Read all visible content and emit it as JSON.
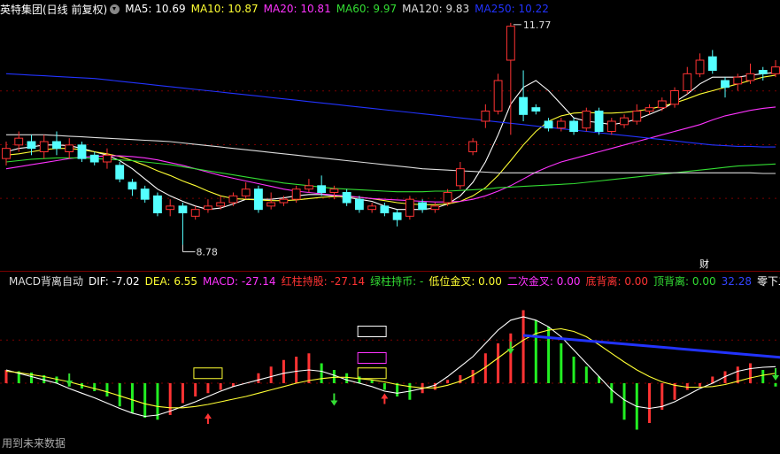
{
  "main_legend": {
    "title": "英特集团(日线 前复权)",
    "items": [
      {
        "label": "MA5: 10.69",
        "color": "#ffffff"
      },
      {
        "label": "MA10: 10.87",
        "color": "#ffff33"
      },
      {
        "label": "MA20: 10.81",
        "color": "#ff33ff"
      },
      {
        "label": "MA60: 9.97",
        "color": "#33dd33"
      },
      {
        "label": "MA120: 9.83",
        "color": "#dddddd"
      },
      {
        "label": "MA250: 10.22",
        "color": "#2233ff"
      }
    ]
  },
  "macd_legend": {
    "title": "MACD背离自动",
    "items": [
      {
        "label": "DIF: -7.02",
        "color": "#ffffff"
      },
      {
        "label": "DEA: 6.55",
        "color": "#ffff33"
      },
      {
        "label": "MACD: -27.14",
        "color": "#ff33ff"
      },
      {
        "label": "红柱持股: -27.14",
        "color": "#ff3333"
      },
      {
        "label": "绿柱持币: -",
        "color": "#33dd33"
      },
      {
        "label": "低位金叉: 0.00",
        "color": "#ffff33"
      },
      {
        "label": "二次金叉: 0.00",
        "color": "#ff33ff"
      },
      {
        "label": "底背离: 0.00",
        "color": "#ff3333"
      },
      {
        "label": "顶背离: 0.00",
        "color": "#33dd33"
      },
      {
        "label": "32.28",
        "color": "#3344ff"
      },
      {
        "label": "零下二次金叉",
        "color": "#ffffff"
      }
    ]
  },
  "annotations": {
    "high_label": "11.77",
    "low_label": "8.78",
    "cai_badge": "财"
  },
  "footer": "用到未来数据",
  "colors": {
    "up": "#ff3333",
    "down": "#54ffff",
    "grid": "#7a0000"
  },
  "chart_data": [
    {
      "type": "candlestick",
      "title": "英特集团(日线 前复权)",
      "ylim": [
        8.5,
        12.1
      ],
      "candles": [
        [
          10.05,
          10.2,
          10.3,
          9.95
        ],
        [
          10.25,
          10.35,
          10.45,
          10.15
        ],
        [
          10.3,
          10.2,
          10.4,
          10.1
        ],
        [
          10.15,
          10.3,
          10.4,
          10.05
        ],
        [
          10.3,
          10.2,
          10.45,
          10.1
        ],
        [
          10.15,
          10.25,
          10.35,
          10.05
        ],
        [
          10.25,
          10.05,
          10.3,
          10.0
        ],
        [
          10.1,
          10.0,
          10.15,
          9.95
        ],
        [
          10.0,
          10.1,
          10.2,
          9.9
        ],
        [
          9.95,
          9.75,
          10.0,
          9.7
        ],
        [
          9.7,
          9.6,
          9.75,
          9.5
        ],
        [
          9.6,
          9.45,
          9.65,
          9.4
        ],
        [
          9.5,
          9.25,
          9.55,
          9.2
        ],
        [
          9.3,
          9.35,
          9.45,
          9.2
        ],
        [
          9.35,
          9.25,
          9.4,
          8.78
        ],
        [
          9.2,
          9.3,
          9.35,
          9.15
        ],
        [
          9.3,
          9.35,
          9.45,
          9.25
        ],
        [
          9.35,
          9.4,
          9.5,
          9.3
        ],
        [
          9.4,
          9.5,
          9.55,
          9.35
        ],
        [
          9.5,
          9.6,
          9.7,
          9.45
        ],
        [
          9.6,
          9.3,
          9.65,
          9.25
        ],
        [
          9.35,
          9.4,
          9.55,
          9.3
        ],
        [
          9.4,
          9.45,
          9.5,
          9.35
        ],
        [
          9.45,
          9.6,
          9.65,
          9.4
        ],
        [
          9.6,
          9.65,
          9.75,
          9.55
        ],
        [
          9.65,
          9.55,
          9.8,
          9.5
        ],
        [
          9.55,
          9.6,
          9.65,
          9.45
        ],
        [
          9.55,
          9.4,
          9.6,
          9.35
        ],
        [
          9.45,
          9.3,
          9.5,
          9.25
        ],
        [
          9.3,
          9.35,
          9.4,
          9.25
        ],
        [
          9.35,
          9.25,
          9.4,
          9.2
        ],
        [
          9.25,
          9.15,
          9.3,
          9.05
        ],
        [
          9.2,
          9.45,
          9.5,
          9.15
        ],
        [
          9.4,
          9.3,
          9.45,
          9.25
        ],
        [
          9.3,
          9.35,
          9.4,
          9.25
        ],
        [
          9.4,
          9.55,
          9.6,
          9.35
        ],
        [
          9.65,
          9.9,
          10.0,
          9.6
        ],
        [
          10.15,
          10.3,
          10.35,
          10.1
        ],
        [
          10.6,
          10.75,
          10.85,
          10.5
        ],
        [
          10.75,
          11.2,
          11.3,
          10.7
        ],
        [
          11.5,
          12.0,
          12.05,
          10.4
        ],
        [
          10.95,
          10.7,
          11.35,
          10.6
        ],
        [
          10.8,
          10.75,
          10.85,
          10.7
        ],
        [
          10.6,
          10.5,
          10.65,
          10.45
        ],
        [
          10.5,
          10.6,
          10.65,
          10.45
        ],
        [
          10.6,
          10.45,
          10.65,
          10.4
        ],
        [
          10.5,
          10.75,
          10.8,
          10.45
        ],
        [
          10.75,
          10.45,
          10.8,
          10.4
        ],
        [
          10.45,
          10.6,
          10.65,
          10.4
        ],
        [
          10.55,
          10.65,
          10.7,
          10.5
        ],
        [
          10.6,
          10.75,
          10.85,
          10.55
        ],
        [
          10.75,
          10.8,
          10.85,
          10.7
        ],
        [
          10.8,
          10.9,
          10.95,
          10.75
        ],
        [
          10.85,
          11.05,
          11.1,
          10.8
        ],
        [
          11.05,
          11.3,
          11.4,
          11.0
        ],
        [
          11.3,
          11.5,
          11.6,
          11.25
        ],
        [
          11.55,
          11.35,
          11.65,
          11.3
        ],
        [
          11.2,
          11.1,
          11.25,
          10.95
        ],
        [
          11.15,
          11.25,
          11.3,
          11.05
        ],
        [
          11.2,
          11.3,
          11.45,
          11.15
        ],
        [
          11.35,
          11.3,
          11.4,
          11.2
        ],
        [
          11.3,
          11.4,
          11.5,
          11.25
        ]
      ],
      "ma_series": [
        {
          "name": "MA5",
          "color": "#ffffff",
          "values": [
            10.15,
            10.2,
            10.22,
            10.25,
            10.25,
            10.24,
            10.2,
            10.15,
            10.1,
            10.02,
            9.9,
            9.75,
            9.6,
            9.5,
            9.42,
            9.35,
            9.3,
            9.32,
            9.38,
            9.45,
            9.45,
            9.45,
            9.47,
            9.5,
            9.52,
            9.52,
            9.5,
            9.48,
            9.45,
            9.42,
            9.35,
            9.3,
            9.3,
            9.3,
            9.32,
            9.38,
            9.5,
            9.7,
            10.0,
            10.4,
            10.85,
            11.1,
            11.2,
            11.05,
            10.85,
            10.65,
            10.6,
            10.58,
            10.55,
            10.58,
            10.63,
            10.7,
            10.78,
            10.88,
            11.0,
            11.15,
            11.25,
            11.25,
            11.25,
            11.28,
            11.3,
            11.32
          ]
        },
        {
          "name": "MA10",
          "color": "#ffff33",
          "values": [
            10.1,
            10.12,
            10.15,
            10.18,
            10.2,
            10.2,
            10.18,
            10.15,
            10.12,
            10.08,
            10.02,
            9.95,
            9.87,
            9.8,
            9.72,
            9.65,
            9.57,
            9.5,
            9.46,
            9.45,
            9.44,
            9.43,
            9.43,
            9.44,
            9.46,
            9.48,
            9.49,
            9.49,
            9.48,
            9.46,
            9.43,
            9.4,
            9.38,
            9.37,
            9.37,
            9.38,
            9.42,
            9.5,
            9.62,
            9.8,
            10.02,
            10.25,
            10.45,
            10.6,
            10.68,
            10.72,
            10.73,
            10.72,
            10.72,
            10.73,
            10.75,
            10.78,
            10.82,
            10.87,
            10.93,
            11.0,
            11.05,
            11.1,
            11.15,
            11.2,
            11.25,
            11.28
          ]
        },
        {
          "name": "MA20",
          "color": "#ff33ff",
          "values": [
            9.9,
            9.93,
            9.96,
            9.99,
            10.02,
            10.05,
            10.07,
            10.08,
            10.09,
            10.09,
            10.08,
            10.06,
            10.03,
            9.99,
            9.95,
            9.9,
            9.85,
            9.8,
            9.76,
            9.72,
            9.68,
            9.64,
            9.6,
            9.57,
            9.55,
            9.53,
            9.51,
            9.5,
            9.48,
            9.46,
            9.45,
            9.44,
            9.43,
            9.42,
            9.41,
            9.41,
            9.42,
            9.45,
            9.5,
            9.57,
            9.65,
            9.75,
            9.85,
            9.93,
            10.0,
            10.05,
            10.1,
            10.15,
            10.2,
            10.25,
            10.3,
            10.35,
            10.4,
            10.45,
            10.5,
            10.55,
            10.62,
            10.68,
            10.72,
            10.76,
            10.79,
            10.81
          ]
        },
        {
          "name": "MA60",
          "color": "#33dd33",
          "values": [
            10.0,
            10.02,
            10.04,
            10.05,
            10.06,
            10.06,
            10.06,
            10.05,
            10.04,
            10.03,
            10.02,
            10.0,
            9.98,
            9.96,
            9.93,
            9.9,
            9.87,
            9.84,
            9.81,
            9.78,
            9.75,
            9.72,
            9.69,
            9.67,
            9.65,
            9.63,
            9.61,
            9.6,
            9.59,
            9.58,
            9.57,
            9.56,
            9.56,
            9.56,
            9.57,
            9.57,
            9.58,
            9.59,
            9.6,
            9.62,
            9.63,
            9.64,
            9.65,
            9.66,
            9.67,
            9.68,
            9.7,
            9.72,
            9.74,
            9.76,
            9.78,
            9.8,
            9.82,
            9.84,
            9.86,
            9.88,
            9.9,
            9.92,
            9.94,
            9.95,
            9.96,
            9.97
          ]
        },
        {
          "name": "MA120",
          "color": "#dddddd",
          "values": [
            10.4,
            10.4,
            10.4,
            10.4,
            10.39,
            10.38,
            10.37,
            10.36,
            10.35,
            10.34,
            10.33,
            10.32,
            10.31,
            10.3,
            10.28,
            10.26,
            10.24,
            10.22,
            10.2,
            10.18,
            10.16,
            10.14,
            10.12,
            10.1,
            10.08,
            10.06,
            10.04,
            10.02,
            10.0,
            9.98,
            9.96,
            9.94,
            9.92,
            9.9,
            9.89,
            9.88,
            9.87,
            9.86,
            9.85,
            9.84,
            9.84,
            9.84,
            9.84,
            9.84,
            9.84,
            9.84,
            9.84,
            9.84,
            9.84,
            9.84,
            9.84,
            9.84,
            9.84,
            9.84,
            9.84,
            9.84,
            9.84,
            9.84,
            9.84,
            9.84,
            9.83,
            9.83
          ]
        },
        {
          "name": "MA250",
          "color": "#2233ff",
          "values": [
            11.3,
            11.29,
            11.28,
            11.27,
            11.26,
            11.25,
            11.24,
            11.23,
            11.21,
            11.19,
            11.17,
            11.15,
            11.13,
            11.11,
            11.09,
            11.07,
            11.05,
            11.03,
            11.01,
            10.99,
            10.97,
            10.95,
            10.93,
            10.91,
            10.89,
            10.87,
            10.85,
            10.83,
            10.81,
            10.79,
            10.77,
            10.75,
            10.73,
            10.71,
            10.69,
            10.67,
            10.65,
            10.63,
            10.61,
            10.59,
            10.57,
            10.55,
            10.53,
            10.51,
            10.49,
            10.47,
            10.45,
            10.43,
            10.41,
            10.39,
            10.37,
            10.35,
            10.33,
            10.31,
            10.29,
            10.27,
            10.25,
            10.24,
            10.23,
            10.23,
            10.22,
            10.22
          ]
        }
      ]
    },
    {
      "type": "bar",
      "title": "MACD背离自动",
      "ylim": [
        -100,
        140
      ],
      "values": [
        20,
        18,
        16,
        12,
        10,
        -5,
        -8,
        -12,
        -20,
        -35,
        -45,
        -52,
        -55,
        -48,
        -30,
        -20,
        -15,
        -10,
        -5,
        0,
        15,
        25,
        35,
        40,
        45,
        30,
        20,
        15,
        10,
        5,
        -10,
        -20,
        -25,
        -15,
        -10,
        5,
        12,
        20,
        45,
        60,
        75,
        110,
        95,
        85,
        60,
        40,
        25,
        10,
        -30,
        -55,
        -70,
        -60,
        -40,
        -25,
        -10,
        -5,
        10,
        18,
        25,
        30,
        20,
        -5
      ],
      "dif": [
        20,
        15,
        10,
        5,
        0,
        -8,
        -15,
        -22,
        -30,
        -38,
        -45,
        -50,
        -48,
        -42,
        -35,
        -28,
        -20,
        -12,
        -5,
        0,
        5,
        10,
        15,
        18,
        20,
        18,
        12,
        5,
        0,
        -5,
        -12,
        -15,
        -12,
        -8,
        -3,
        10,
        25,
        40,
        60,
        80,
        95,
        100,
        95,
        85,
        70,
        50,
        30,
        10,
        -10,
        -25,
        -35,
        -38,
        -35,
        -28,
        -18,
        -8,
        0,
        10,
        18,
        22,
        24,
        25
      ],
      "dea": [
        18,
        16,
        13,
        10,
        6,
        2,
        -3,
        -8,
        -13,
        -19,
        -25,
        -31,
        -35,
        -37,
        -37,
        -35,
        -32,
        -28,
        -24,
        -20,
        -15,
        -10,
        -5,
        0,
        4,
        7,
        9,
        9,
        7,
        5,
        2,
        -2,
        -5,
        -7,
        -7,
        -3,
        3,
        12,
        24,
        38,
        52,
        65,
        75,
        80,
        82,
        78,
        70,
        58,
        45,
        32,
        20,
        10,
        2,
        -3,
        -6,
        -6,
        -5,
        -2,
        3,
        8,
        12,
        15
      ],
      "markers": [
        {
          "type": "outline-box",
          "color": "#ffffff",
          "x": 29,
          "y": 70
        },
        {
          "type": "outline-box",
          "color": "#ff33ff",
          "x": 29,
          "y": 30
        },
        {
          "type": "outline-box",
          "color": "#ffff33",
          "x": 29,
          "y": 7
        },
        {
          "type": "outline-box",
          "color": "#ffff33",
          "x": 16,
          "y": 7
        },
        {
          "type": "arrow-down",
          "color": "#33dd33",
          "x": 5,
          "y": 12
        },
        {
          "type": "arrow-up",
          "color": "#ff3333",
          "x": 16,
          "y": -48
        },
        {
          "type": "arrow-down",
          "color": "#33dd33",
          "x": 26,
          "y": -18
        },
        {
          "type": "arrow-up",
          "color": "#ff3333",
          "x": 30,
          "y": -18
        },
        {
          "type": "arrow-down",
          "color": "#33dd33",
          "x": 40,
          "y": 60
        },
        {
          "type": "arrow-down",
          "color": "#33dd33",
          "x": 61,
          "y": 20
        }
      ],
      "divergence_line": {
        "color": "#2233ff",
        "x1": 41,
        "y1": 72,
        "x2": 62,
        "y2": 38
      }
    }
  ]
}
